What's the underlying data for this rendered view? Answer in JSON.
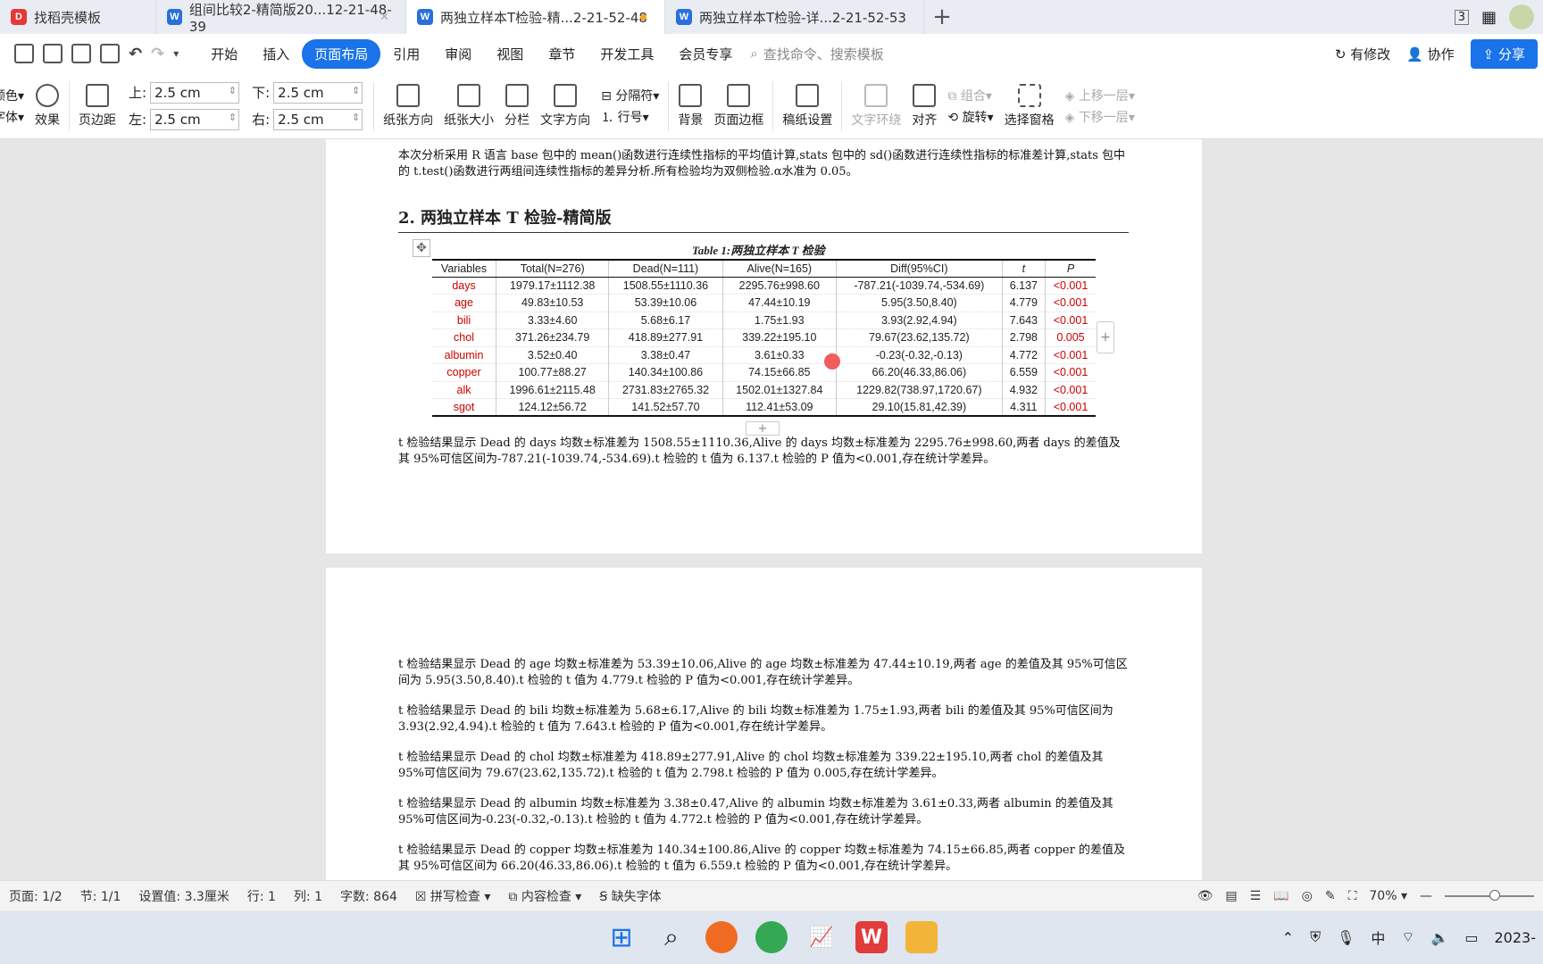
{
  "tabs": [
    {
      "label": "找稻壳模板",
      "icon_color": "#e53935",
      "icon_char": "D"
    },
    {
      "label": "组间比较2-精简版20...12-21-48-39",
      "icon_color": "#2a6fdb",
      "icon_char": "W",
      "closable": true
    },
    {
      "label": "两独立样本T检验-精...2-21-52-48",
      "icon_color": "#2a6fdb",
      "icon_char": "W",
      "active": true,
      "modified": true
    },
    {
      "label": "两独立样本T检验-详...2-21-52-53",
      "icon_color": "#2a6fdb",
      "icon_char": "W"
    }
  ],
  "topright": {
    "badge": "3"
  },
  "menu": {
    "items": [
      "开始",
      "插入",
      "页面布局",
      "引用",
      "审阅",
      "视图",
      "章节",
      "开发工具",
      "会员专享"
    ],
    "active": "页面布局",
    "search_placeholder": "查找命令、搜索模板",
    "modified": "有修改",
    "collab": "协作",
    "share": "分享"
  },
  "ribbon": {
    "color_label": "颜色",
    "font_label": "字体",
    "effect": "效果",
    "margins": "页边距",
    "top_label": "上:",
    "top_val": "2.5 cm",
    "left_label": "左:",
    "left_val": "2.5 cm",
    "bottom_label": "下:",
    "bottom_val": "2.5 cm",
    "right_label": "右:",
    "right_val": "2.5 cm",
    "orientation": "纸张方向",
    "size": "纸张大小",
    "columns": "分栏",
    "text_dir": "文字方向",
    "separator": "分隔符",
    "line_no": "行号",
    "background": "背景",
    "border": "页面边框",
    "grid": "稿纸设置",
    "wrap": "文字环绕",
    "align": "对齐",
    "group": "组合",
    "rotate": "旋转",
    "select_pane": "选择窗格",
    "bring_up": "上移一层",
    "send_down": "下移一层"
  },
  "doc": {
    "intro": "本次分析采用 R 语言 base 包中的 mean()函数进行连续性指标的平均值计算,stats 包中的 sd()函数进行连续性指标的标准差计算,stats 包中的 t.test()函数进行两组间连续性指标的差异分析.所有检验均为双侧检验.α水准为 0.05。",
    "heading": "2. 两独立样本 T 检验-精简版",
    "table_title": "Table 1:两独立样本 T 检验",
    "table_headers": [
      "Variables",
      "Total(N=276)",
      "Dead(N=111)",
      "Alive(N=165)",
      "Diff(95%CI)",
      "t",
      "P"
    ],
    "table_rows": [
      [
        "days",
        "1979.17±1112.38",
        "1508.55±1110.36",
        "2295.76±998.60",
        "-787.21(-1039.74,-534.69)",
        "6.137",
        "<0.001"
      ],
      [
        "age",
        "49.83±10.53",
        "53.39±10.06",
        "47.44±10.19",
        "5.95(3.50,8.40)",
        "4.779",
        "<0.001"
      ],
      [
        "bili",
        "3.33±4.60",
        "5.68±6.17",
        "1.75±1.93",
        "3.93(2.92,4.94)",
        "7.643",
        "<0.001"
      ],
      [
        "chol",
        "371.26±234.79",
        "418.89±277.91",
        "339.22±195.10",
        "79.67(23.62,135.72)",
        "2.798",
        "0.005"
      ],
      [
        "albumin",
        "3.52±0.40",
        "3.38±0.47",
        "3.61±0.33",
        "-0.23(-0.32,-0.13)",
        "4.772",
        "<0.001"
      ],
      [
        "copper",
        "100.77±88.27",
        "140.34±100.86",
        "74.15±66.85",
        "66.20(46.33,86.06)",
        "6.559",
        "<0.001"
      ],
      [
        "alk",
        "1996.61±2115.48",
        "2731.83±2765.32",
        "1502.01±1327.84",
        "1229.82(738.97,1720.67)",
        "4.932",
        "<0.001"
      ],
      [
        "sgot",
        "124.12±56.72",
        "141.52±57.70",
        "112.41±53.09",
        "29.10(15.81,42.39)",
        "4.311",
        "<0.001"
      ]
    ],
    "para_days": "t 检验结果显示 Dead 的 days 均数±标准差为 1508.55±1110.36,Alive 的 days 均数±标准差为 2295.76±998.60,两者 days 的差值及其 95%可信区间为-787.21(-1039.74,-534.69).t 检验的 t 值为 6.137.t 检验的 P 值为<0.001,存在统计学差异。",
    "para_age": "t 检验结果显示 Dead 的 age 均数±标准差为 53.39±10.06,Alive 的 age 均数±标准差为 47.44±10.19,两者 age 的差值及其 95%可信区间为 5.95(3.50,8.40).t 检验的 t 值为 4.779.t 检验的 P 值为<0.001,存在统计学差异。",
    "para_bili": "t 检验结果显示 Dead 的 bili 均数±标准差为 5.68±6.17,Alive 的 bili 均数±标准差为 1.75±1.93,两者 bili 的差值及其 95%可信区间为 3.93(2.92,4.94).t 检验的 t 值为 7.643.t 检验的 P 值为<0.001,存在统计学差异。",
    "para_chol": "t 检验结果显示 Dead 的 chol 均数±标准差为 418.89±277.91,Alive 的 chol 均数±标准差为 339.22±195.10,两者 chol 的差值及其 95%可信区间为 79.67(23.62,135.72).t 检验的 t 值为 2.798.t 检验的 P 值为 0.005,存在统计学差异。",
    "para_albumin": "t 检验结果显示 Dead 的 albumin 均数±标准差为 3.38±0.47,Alive 的 albumin 均数±标准差为 3.61±0.33,两者 albumin 的差值及其 95%可信区间为-0.23(-0.32,-0.13).t 检验的 t 值为 4.772.t 检验的 P 值为<0.001,存在统计学差异。",
    "para_copper": "t 检验结果显示 Dead 的 copper 均数±标准差为 140.34±100.86,Alive 的 copper 均数±标准差为 74.15±66.85,两者 copper 的差值及其 95%可信区间为 66.20(46.33,86.06).t 检验的 t 值为 6.559.t 检验的 P 值为<0.001,存在统计学差异。"
  },
  "status": {
    "page": "页面: 1/2",
    "section": "节: 1/1",
    "setting": "设置值: 3.3厘米",
    "row": "行: 1",
    "col": "列: 1",
    "words": "字数: 864",
    "spell": "拼写检查",
    "content": "内容检查",
    "missing_font": "缺失字体",
    "zoom": "70%"
  },
  "tray": {
    "ime": "中",
    "date": "2023-"
  }
}
